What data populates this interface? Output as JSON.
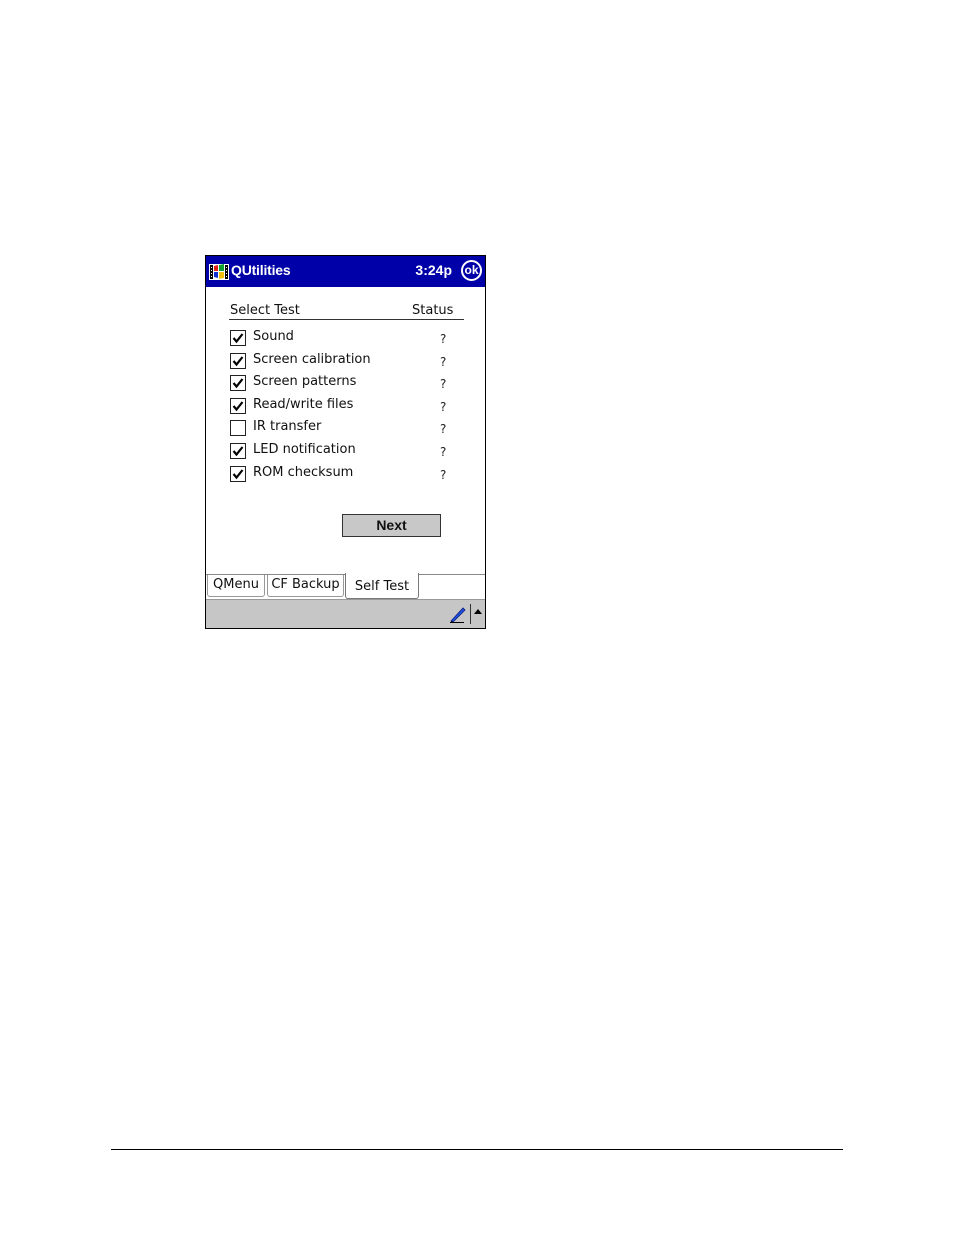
{
  "window": {
    "app_icon": "windows-flag-icon",
    "title": "QUtilities",
    "clock": "3:24p",
    "ok_label": "ok"
  },
  "columns": {
    "select": "Select Test",
    "status": "Status"
  },
  "tests": [
    {
      "label": "Sound",
      "checked": true,
      "status": "?"
    },
    {
      "label": "Screen calibration",
      "checked": true,
      "status": "?"
    },
    {
      "label": "Screen patterns",
      "checked": true,
      "status": "?"
    },
    {
      "label": "Read/write files",
      "checked": true,
      "status": "?"
    },
    {
      "label": "IR transfer",
      "checked": false,
      "status": "?"
    },
    {
      "label": "LED notification",
      "checked": true,
      "status": "?"
    },
    {
      "label": "ROM checksum",
      "checked": true,
      "status": "?"
    }
  ],
  "next_button": "Next",
  "tabs": [
    {
      "label": "QMenu",
      "active": false
    },
    {
      "label": "CF Backup",
      "active": false
    },
    {
      "label": "Self Test",
      "active": true
    }
  ],
  "menubar": {
    "input_icon": "pen-icon",
    "sip_toggle_icon": "up-arrow-icon"
  }
}
